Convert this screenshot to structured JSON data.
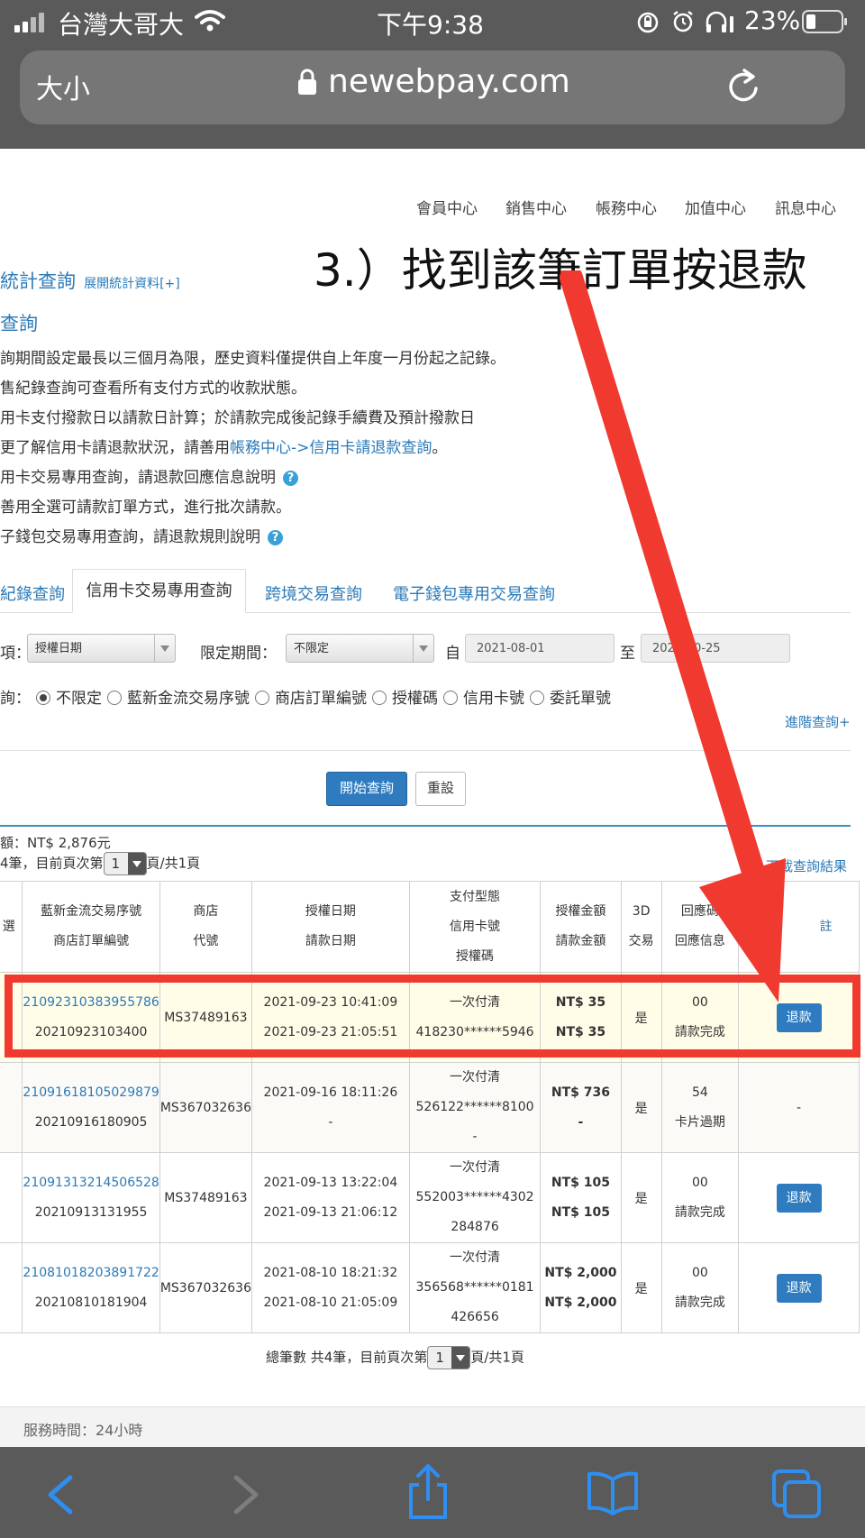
{
  "status_bar": {
    "carrier": "台灣大哥大",
    "time": "下午9:38",
    "battery": "23%"
  },
  "browser": {
    "text_size": "大小",
    "url": "newebpay.com"
  },
  "top_nav": [
    "會員中心",
    "銷售中心",
    "帳務中心",
    "加值中心",
    "訊息中心"
  ],
  "annotation": "3.）找到該筆訂單按退款",
  "section": {
    "title": "統計查詢",
    "expand_link": "展開統計資料[+]",
    "subtitle": "查詢"
  },
  "notes": [
    {
      "text": "詢期間設定最長以三個月為限，歷史資料僅提供自上年度一月份起之記錄。"
    },
    {
      "text": "售紀錄查詢可查看所有支付方式的收款狀態。"
    },
    {
      "text": "用卡支付撥款日以請款日計算；於請款完成後記錄手續費及預計撥款日"
    },
    {
      "text": "更了解信用卡請退款狀況，請善用",
      "link": "帳務中心->信用卡請退款查詢",
      "suffix": "。"
    },
    {
      "text": "用卡交易專用查詢，請退款回應信息說明",
      "help": "?"
    },
    {
      "text": "善用全選可請款訂單方式，進行批次請款。"
    },
    {
      "text": "子錢包交易專用查詢，請退款規則說明",
      "help": "?"
    }
  ],
  "tabs": [
    "紀錄查詢",
    "信用卡交易專用查詢",
    "跨境交易查詢",
    "電子錢包專用交易查詢"
  ],
  "filters": {
    "type_label": "項：",
    "type_value": "授權日期",
    "period_label": "限定期間：",
    "period_value": "不限定",
    "from_label": "自",
    "from_value": "2021-08-01",
    "to_label": "至",
    "to_value": "2021-10-25"
  },
  "search_options": {
    "label": "詢：",
    "options": [
      "不限定",
      "藍新金流交易序號",
      "商店訂單編號",
      "授權碼",
      "信用卡號",
      "委託單號"
    ],
    "selected": "不限定"
  },
  "advanced_link": "進階查詢+",
  "buttons": {
    "search": "開始查詢",
    "reset": "重設"
  },
  "summary": {
    "total": "額：NT$ 2,876元",
    "pager_prefix": "4筆，目前頁次第",
    "page": "1",
    "pager_suffix": "頁/共1頁",
    "download": "下載查詢結果"
  },
  "table": {
    "headers": {
      "select": "選",
      "txn": [
        "藍新金流交易序號",
        "商店訂單編號"
      ],
      "store": [
        "商店",
        "代號"
      ],
      "date": [
        "授權日期",
        "請款日期"
      ],
      "pay": [
        "支付型態",
        "信用卡號",
        "授權碼"
      ],
      "amount": [
        "授權金額",
        "請款金額"
      ],
      "three_d": [
        "3D",
        "交易"
      ],
      "resp": [
        "回應碼",
        "回應信息"
      ],
      "remark": "註"
    },
    "rows": [
      {
        "txn": "21092310383955786",
        "order": "20210923103400",
        "store": "MS37489163",
        "auth_date": "2021-09-23 10:41:09",
        "capture_date": "2021-09-23 21:05:51",
        "pay_type": "一次付清",
        "card": "418230******5946",
        "auth_code": "",
        "auth_amount": "NT$ 35",
        "capture_amount": "NT$ 35",
        "three_d": "是",
        "resp_code": "00",
        "resp_msg": "請款完成",
        "action": "退款"
      },
      {
        "txn": "21091618105029879",
        "order": "20210916180905",
        "store": "MS367032636",
        "auth_date": "2021-09-16 18:11:26",
        "capture_date": "-",
        "pay_type": "一次付清",
        "card": "526122******8100",
        "auth_code": "-",
        "auth_amount": "NT$ 736",
        "capture_amount": "-",
        "three_d": "是",
        "resp_code": "54",
        "resp_msg": "卡片過期",
        "action": "-"
      },
      {
        "txn": "21091313214506528",
        "order": "20210913131955",
        "store": "MS37489163",
        "auth_date": "2021-09-13 13:22:04",
        "capture_date": "2021-09-13 21:06:12",
        "pay_type": "一次付清",
        "card": "552003******4302",
        "auth_code": "284876",
        "auth_amount": "NT$ 105",
        "capture_amount": "NT$ 105",
        "three_d": "是",
        "resp_code": "00",
        "resp_msg": "請款完成",
        "action": "退款"
      },
      {
        "txn": "21081018203891722",
        "order": "20210810181904",
        "store": "MS367032636",
        "auth_date": "2021-08-10 18:21:32",
        "capture_date": "2021-08-10 21:05:09",
        "pay_type": "一次付清",
        "card": "356568******0181",
        "auth_code": "426656",
        "auth_amount": "NT$ 2,000",
        "capture_amount": "NT$ 2,000",
        "three_d": "是",
        "resp_code": "00",
        "resp_msg": "請款完成",
        "action": "退款"
      }
    ]
  },
  "bottom_pager": {
    "prefix": "總筆數 共4筆，目前頁次第",
    "page": "1",
    "suffix": "頁/共1頁"
  },
  "footer": {
    "service": "服務時間：24小時"
  },
  "colors": {
    "link": "#2a7ab8",
    "button": "#2f7bbf",
    "highlight": "#f03a30",
    "arrow": "#f03a30"
  }
}
